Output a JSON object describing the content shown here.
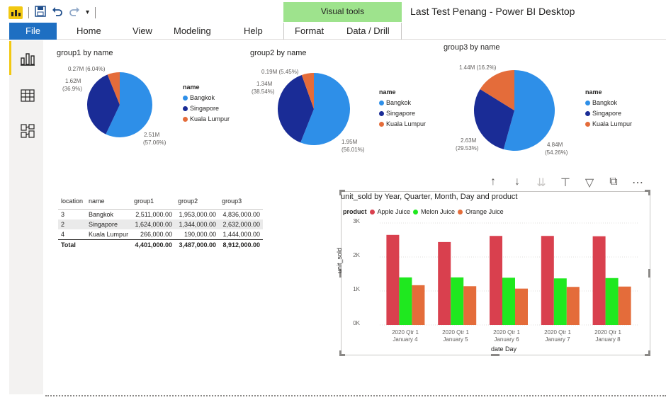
{
  "window": {
    "title": "Last Test Penang - Power BI Desktop",
    "contextual_group": "Visual tools"
  },
  "ribbon": {
    "file": "File",
    "tabs": [
      "Home",
      "View",
      "Modeling",
      "Help",
      "Format",
      "Data / Drill"
    ]
  },
  "pies": [
    {
      "title": "group1 by name",
      "legend_title": "name",
      "slices": [
        {
          "name": "Bangkok",
          "value": 2.51,
          "label": "2.51M",
          "pct": "(57.06%)"
        },
        {
          "name": "Singapore",
          "value": 1.62,
          "label": "1.62M",
          "pct": "(36.9%)"
        },
        {
          "name": "Kuala Lumpur",
          "value": 0.27,
          "label": "0.27M (6.04%)",
          "pct": ""
        }
      ]
    },
    {
      "title": "group2 by name",
      "legend_title": "name",
      "slices": [
        {
          "name": "Bangkok",
          "value": 1.95,
          "label": "1.95M",
          "pct": "(56.01%)"
        },
        {
          "name": "Singapore",
          "value": 1.34,
          "label": "1.34M",
          "pct": "(38.54%)"
        },
        {
          "name": "Kuala Lumpur",
          "value": 0.19,
          "label": "0.19M (5.45%)",
          "pct": ""
        }
      ]
    },
    {
      "title": "group3 by name",
      "legend_title": "name",
      "slices": [
        {
          "name": "Bangkok",
          "value": 4.84,
          "label": "4.84M",
          "pct": "(54.26%)"
        },
        {
          "name": "Singapore",
          "value": 2.63,
          "label": "2.63M",
          "pct": "(29.53%)"
        },
        {
          "name": "Kuala Lumpur",
          "value": 1.44,
          "label": "1.44M (16.2%)",
          "pct": ""
        }
      ]
    }
  ],
  "colors": {
    "bangkok": "#2e8fe8",
    "singapore": "#1a2c96",
    "kuala_lumpur": "#e46c3a",
    "apple_juice": "#d9404e",
    "melon_juice": "#1fe81f",
    "orange_juice": "#e46c3a",
    "brand": "#f2c811",
    "file_tab": "#1e6fc2"
  },
  "matrix": {
    "headers": [
      "location",
      "name",
      "group1",
      "group2",
      "group3"
    ],
    "rows": [
      [
        "3",
        "Bangkok",
        "2,511,000.00",
        "1,953,000.00",
        "4,836,000.00"
      ],
      [
        "2",
        "Singapore",
        "1,624,000.00",
        "1,344,000.00",
        "2,632,000.00"
      ],
      [
        "4",
        "Kuala Lumpur",
        "266,000.00",
        "190,000.00",
        "1,444,000.00"
      ]
    ],
    "total": [
      "Total",
      "",
      "4,401,000.00",
      "3,487,000.00",
      "8,912,000.00"
    ]
  },
  "chart_data": {
    "type": "bar",
    "title": "unit_sold by Year, Quarter, Month, Day and product",
    "legend_title": "product",
    "xlabel": "date Day",
    "ylabel": "unit_sold",
    "ylim": [
      0,
      3000
    ],
    "yticks": [
      "0K",
      "1K",
      "2K",
      "3K"
    ],
    "categories": [
      [
        "2020 Qtr 1",
        "January 4"
      ],
      [
        "2020 Qtr 1",
        "January 5"
      ],
      [
        "2020 Qtr 1",
        "January 6"
      ],
      [
        "2020 Qtr 1",
        "January 7"
      ],
      [
        "2020 Qtr 1",
        "January 8"
      ]
    ],
    "series": [
      {
        "name": "Apple Juice",
        "values": [
          2650,
          2440,
          2620,
          2620,
          2610
        ]
      },
      {
        "name": "Melon Juice",
        "values": [
          1400,
          1400,
          1390,
          1370,
          1380
        ]
      },
      {
        "name": "Orange Juice",
        "values": [
          1170,
          1140,
          1070,
          1120,
          1130
        ]
      }
    ]
  }
}
